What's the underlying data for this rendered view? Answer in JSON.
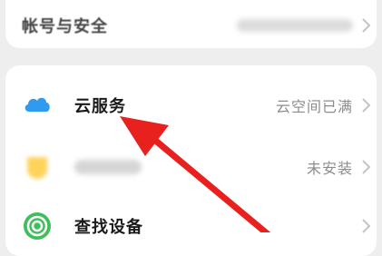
{
  "account_security": {
    "label": "帐号与安全"
  },
  "cloud_service": {
    "label": "云服务",
    "status": "云空间已满",
    "icon": "cloud-icon"
  },
  "blurred_item": {
    "status": "未安装",
    "icon": "yellow-app-icon"
  },
  "find_device": {
    "label": "查找设备",
    "icon": "find-device-icon"
  },
  "annotation": {
    "color": "#e8201e",
    "icon": "red-arrow"
  },
  "colors": {
    "background": "#eeeeef",
    "card": "#ffffff",
    "cloud_blue": "#2f9bf0",
    "find_green": "#3fbf5c",
    "blurred_yellow": "#ffd35a"
  }
}
